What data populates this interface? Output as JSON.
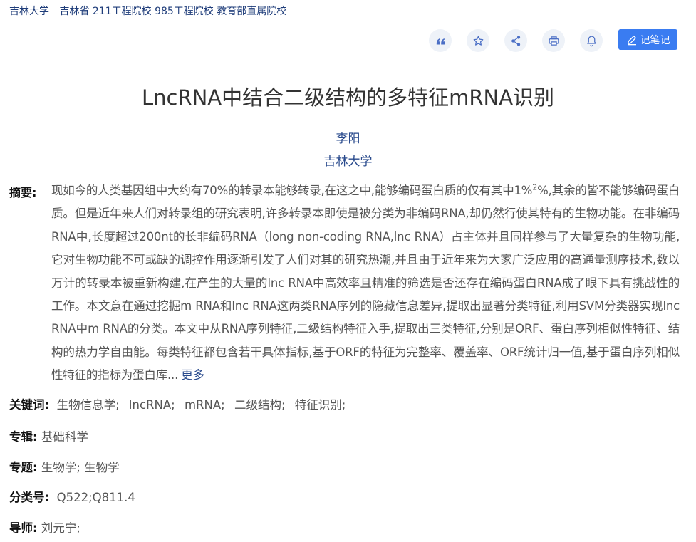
{
  "header": {
    "school": "吉林大学",
    "tags": "吉林省 211工程院校 985工程院校 教育部直属院校"
  },
  "toolbar": {
    "icons": [
      "quote-icon",
      "star-icon",
      "share-icon",
      "print-icon",
      "bell-icon"
    ],
    "note_label": "记笔记",
    "accent_color": "#3a7cf1"
  },
  "paper": {
    "title": "LncRNA中结合二级结构的多特征mRNA识别",
    "author": "李阳",
    "affiliation": "吉林大学",
    "abstract_label": "摘要:",
    "abstract_pre": "现如今的人类基因组中大约有70%的转录本能够转录,在这之中,能够编码蛋白质的仅有其中1%",
    "abstract_sup": "2",
    "abstract_post": "%,其余的皆不能够编码蛋白质。但是近年来人们对转录组的研究表明,许多转录本即使是被分类为非编码RNA,却仍然行使其特有的生物功能。在非编码RNA中,长度超过200nt的长非编码RNA（long non-coding RNA,lnc RNA）占主体并且同样参与了大量复杂的生物功能,它对生物功能不可或缺的调控作用逐渐引发了人们对其的研究热潮,并且由于近年来为大家广泛应用的高通量测序技术,数以万计的转录本被重新构建,在产生的大量的lnc RNA中高效率且精准的筛选是否还存在编码蛋白RNA成了眼下具有挑战性的工作。本文意在通过挖掘m RNA和lnc RNA这两类RNA序列的隐藏信息差异,提取出显著分类特征,利用SVM分类器实现lnc RNA中m RNA的分类。本文中从RNA序列特征,二级结构特征入手,提取出三类特征,分别是ORF、蛋白序列相似性特征、结构的热力学自由能。每类特征都包含若干具体指标,基于ORF的特征为完整率、覆盖率、ORF统计归一值,基于蛋白序列相似性特征的指标为蛋白库...",
    "more_label": "更多",
    "keywords_label": "关键词:",
    "keywords": [
      "生物信息学;",
      "lncRNA;",
      "mRNA;",
      "二级结构;",
      "特征识别;"
    ],
    "series_label": "专辑:",
    "series": "基础科学",
    "topic_label": "专题:",
    "topic": "生物学; 生物学",
    "class_label": "分类号:",
    "class_code": "Q522;Q811.4",
    "advisor_label": "导师:",
    "advisor": "刘元宁;"
  }
}
